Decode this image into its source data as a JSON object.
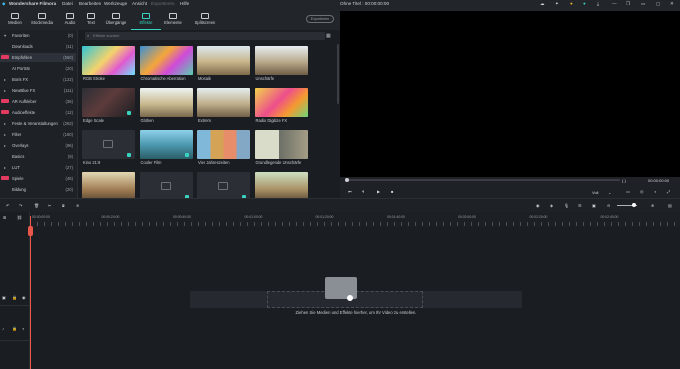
{
  "app": {
    "name": "Wondershare Filmora",
    "project_title": "Ohne Titel : 00:00:00:00"
  },
  "menu": [
    "Datei",
    "Bearbeiten",
    "Werkzeuge",
    "Ansicht",
    "Exportieren",
    "Hilfe"
  ],
  "toolbar": {
    "tabs": [
      {
        "label": "Medien",
        "icon": "media-icon"
      },
      {
        "label": "Stockmedia",
        "icon": "stock-icon"
      },
      {
        "label": "Audio",
        "icon": "audio-icon"
      },
      {
        "label": "Text",
        "icon": "text-icon"
      },
      {
        "label": "Übergänge",
        "icon": "transition-icon"
      },
      {
        "label": "Effekte",
        "icon": "effects-icon",
        "active": true
      },
      {
        "label": "Elemente",
        "icon": "elements-icon"
      },
      {
        "label": "Splitscreen",
        "icon": "splitscreen-icon"
      }
    ],
    "export_label": "Exportieren"
  },
  "sidebar": {
    "items": [
      {
        "label": "Favoriten",
        "count": "(0)",
        "arrow": "♥"
      },
      {
        "label": "Downloads",
        "count": "(11)"
      },
      {
        "label": "Empfohlen",
        "count": "(550)",
        "selected": true,
        "badge": true
      },
      {
        "label": "AI Porträt",
        "count": "(20)"
      },
      {
        "label": "Boris FX",
        "count": "(122)",
        "arrow": "▸"
      },
      {
        "label": "NewBlue FX",
        "count": "(111)",
        "arrow": "▸"
      },
      {
        "label": "AR Aufkleber",
        "count": "(36)",
        "badge": true
      },
      {
        "label": "Audioeffekte",
        "count": "(12)",
        "badge": true
      },
      {
        "label": "Feste & Veranstaltungen",
        "count": "(263)",
        "arrow": "▸"
      },
      {
        "label": "Filter",
        "count": "(180)",
        "arrow": "▸"
      },
      {
        "label": "Overlays",
        "count": "(96)",
        "arrow": "▸"
      },
      {
        "label": "Basics",
        "count": "(9)"
      },
      {
        "label": "LUT",
        "count": "(27)",
        "arrow": "▸"
      },
      {
        "label": "Spiele",
        "count": "(46)",
        "badge": true
      },
      {
        "label": "Bildung",
        "count": "(20)"
      }
    ]
  },
  "effects": {
    "search_placeholder": "Effekte suchen",
    "cards": [
      {
        "name": "RGB Stroke"
      },
      {
        "name": "Chromatische Aberration"
      },
      {
        "name": "Mosaik"
      },
      {
        "name": "Unschärfe"
      },
      {
        "name": "Edge Scale"
      },
      {
        "name": "Glühen"
      },
      {
        "name": "Extrem"
      },
      {
        "name": "Radio Digitize FX"
      },
      {
        "name": "Kino 21:9"
      },
      {
        "name": "Cooler Film"
      },
      {
        "name": "Vier Jahreszeiten"
      },
      {
        "name": "Grundlegende Unschärfe"
      },
      {
        "name": ""
      },
      {
        "name": ""
      },
      {
        "name": ""
      },
      {
        "name": ""
      }
    ]
  },
  "preview": {
    "time_left": "{ }",
    "time_right": "00:00:00:00",
    "quality": "Voll"
  },
  "timeline": {
    "ruler": [
      "00:00:00:00",
      "00:00:20:00",
      "00:00:40:00",
      "00:01:00:00",
      "00:01:20:00",
      "00:01:40:00",
      "00:02:00:00",
      "00:02:20:00",
      "00:02:40:00"
    ],
    "drop_hint": "Ziehen Sie Medien und Effekte hierher, um Ihr Video zu erstellen."
  }
}
